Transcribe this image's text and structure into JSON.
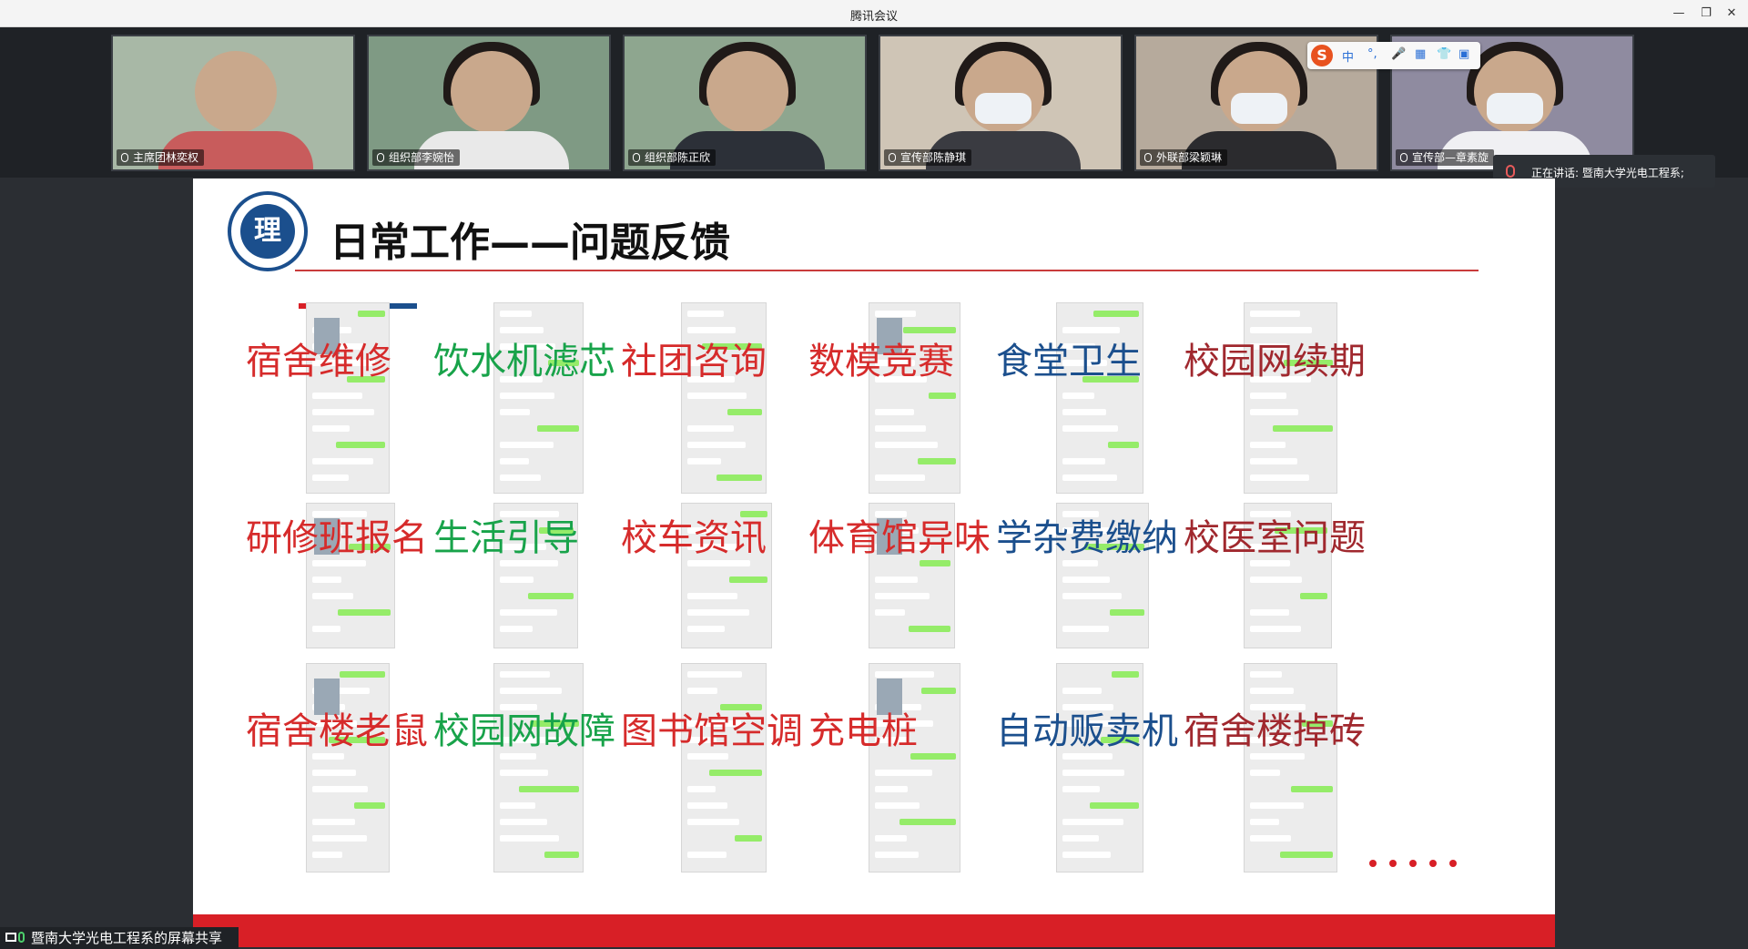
{
  "window": {
    "title": "腾讯会议",
    "minimize": "—",
    "maximize": "❐",
    "close": "✕"
  },
  "participants": [
    {
      "name": "主席团林奕权",
      "bg": "#a8b8a6",
      "body": "#c85c5c"
    },
    {
      "name": "组织部李婉怡",
      "bg": "#7f9a84",
      "body": "#e9e9e9"
    },
    {
      "name": "组织部陈正欣",
      "bg": "#8ea68f",
      "body": "#2c3038"
    },
    {
      "name": "宣传部陈静琪",
      "bg": "#cfc5b6",
      "body": "#3a3b41"
    },
    {
      "name": "外联部梁颖琳",
      "bg": "#b6aa9c",
      "body": "#2b2b2e"
    },
    {
      "name": "宣传部—章素旋",
      "bg": "#8f8ba0",
      "body": "#f0f0f3"
    }
  ],
  "ime": {
    "logo": "S",
    "items": [
      "中",
      "°,",
      "🎤",
      "▦",
      "👕",
      "▣"
    ]
  },
  "speaking": {
    "label": "正在讲话: 暨南大学光电工程系;"
  },
  "slide": {
    "heading": "日常工作——问题反馈",
    "emblem_text": "理",
    "stripe_colors": [
      "#d81f26",
      "#1b4f8d",
      "#d81f26",
      "#1b4f8d"
    ],
    "labels": [
      {
        "text": "宿舍维修",
        "color": "red"
      },
      {
        "text": "饮水机滤芯",
        "color": "green"
      },
      {
        "text": "社团咨询",
        "color": "red"
      },
      {
        "text": "数模竞赛",
        "color": "red"
      },
      {
        "text": "食堂卫生",
        "color": "blue"
      },
      {
        "text": "校园网续期",
        "color": "darkred"
      },
      {
        "text": "研修班报名",
        "color": "red"
      },
      {
        "text": "生活引导",
        "color": "green"
      },
      {
        "text": "校车资讯",
        "color": "red"
      },
      {
        "text": "体育馆异味",
        "color": "red"
      },
      {
        "text": "学杂费缴纳",
        "color": "blue"
      },
      {
        "text": "校医室问题",
        "color": "darkred"
      },
      {
        "text": "宿舍楼老鼠",
        "color": "red"
      },
      {
        "text": "校园网故障",
        "color": "green"
      },
      {
        "text": "图书馆空调",
        "color": "red"
      },
      {
        "text": "充电桩",
        "color": "red"
      },
      {
        "text": "自动贩卖机",
        "color": "blue"
      },
      {
        "text": "宿舍楼掉砖",
        "color": "darkred"
      }
    ]
  },
  "share": {
    "label": "暨南大学光电工程系的屏幕共享"
  }
}
